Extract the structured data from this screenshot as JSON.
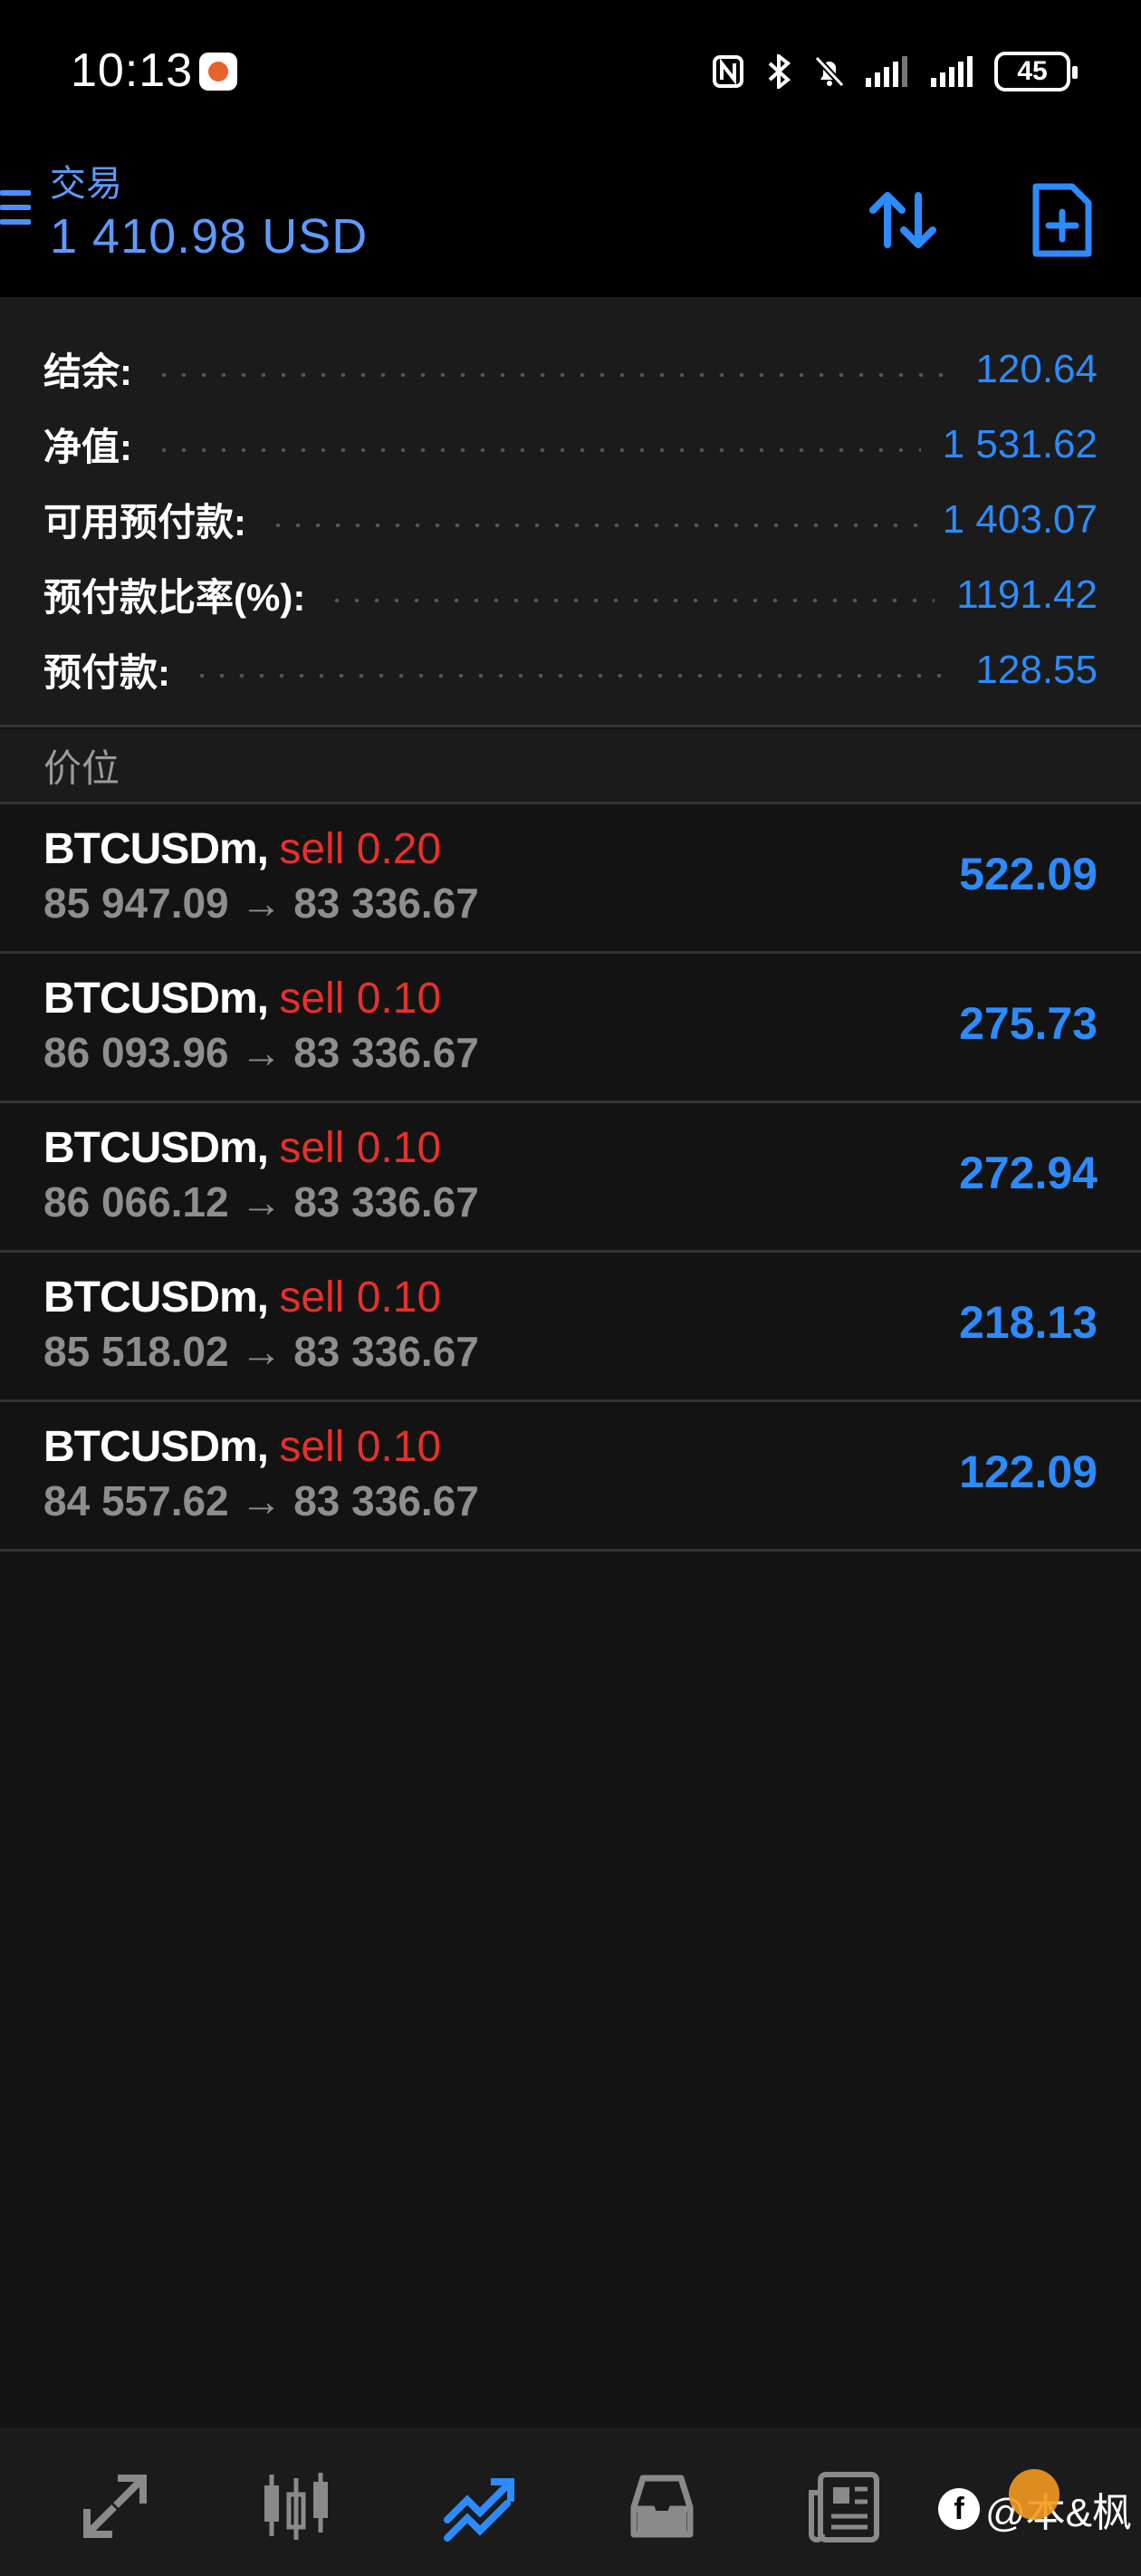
{
  "status_bar": {
    "time": "10:13",
    "battery": "45",
    "icons": [
      "nfc-icon",
      "bluetooth-icon",
      "mute-icon",
      "signal-icon",
      "signal-icon"
    ]
  },
  "header": {
    "title": "交易",
    "balance": "1 410.98 USD"
  },
  "summary": [
    {
      "label": "结余:",
      "value": "120.64"
    },
    {
      "label": "净值:",
      "value": "1 531.62"
    },
    {
      "label": "可用预付款:",
      "value": "1 403.07"
    },
    {
      "label": "预付款比率(%):",
      "value": "1191.42"
    },
    {
      "label": "预付款:",
      "value": "128.55"
    }
  ],
  "section_title": "价位",
  "positions": [
    {
      "symbol": "BTCUSDm,",
      "action": "sell 0.20",
      "open": "85 947.09",
      "arrow": "→",
      "current": "83 336.67",
      "profit": "522.09"
    },
    {
      "symbol": "BTCUSDm,",
      "action": "sell 0.10",
      "open": "86 093.96",
      "arrow": "→",
      "current": "83 336.67",
      "profit": "275.73"
    },
    {
      "symbol": "BTCUSDm,",
      "action": "sell 0.10",
      "open": "86 066.12",
      "arrow": "→",
      "current": "83 336.67",
      "profit": "272.94"
    },
    {
      "symbol": "BTCUSDm,",
      "action": "sell 0.10",
      "open": "85 518.02",
      "arrow": "→",
      "current": "83 336.67",
      "profit": "218.13"
    },
    {
      "symbol": "BTCUSDm,",
      "action": "sell 0.10",
      "open": "84 557.62",
      "arrow": "→",
      "current": "83 336.67",
      "profit": "122.09"
    }
  ],
  "bottom_nav": [
    "quotes-icon",
    "chart-icon",
    "trade-icon",
    "history-icon",
    "news-icon"
  ],
  "watermark": {
    "text": "@本&枫"
  },
  "colors": {
    "accent": "#2c8bff",
    "sell": "#e8302c",
    "header_text": "#5d9bff",
    "background": "#131313"
  }
}
